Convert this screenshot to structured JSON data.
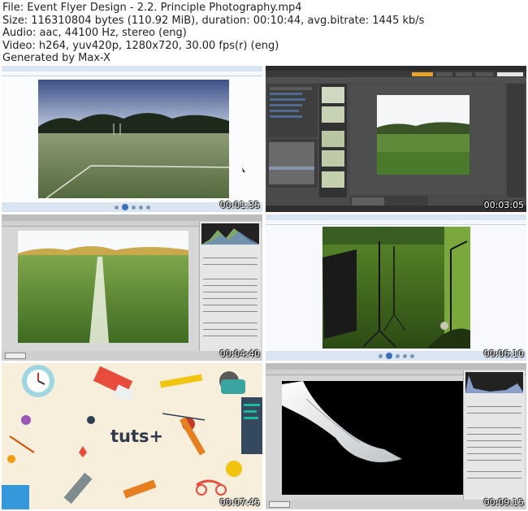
{
  "header": {
    "file_line": "File: Event Flyer Design - 2.2. Principle Photography.mp4",
    "size_line": "Size: 116310804 bytes (110.92 MiB), duration: 00:10:44, avg.bitrate: 1445 kb/s",
    "audio_line": "Audio: aac, 44100 Hz, stereo (eng)",
    "video_line": "Video: h264, yuv420p, 1280x720, 30.00 fps(r) (eng)",
    "generated_line": "Generated by Max-X"
  },
  "thumbnails": [
    {
      "timestamp": "00:01:35",
      "scene": "windows-photo-viewer-field"
    },
    {
      "timestamp": "00:03:05",
      "scene": "adobe-bridge-field"
    },
    {
      "timestamp": "00:04:40",
      "scene": "camera-raw-field-line"
    },
    {
      "timestamp": "00:06:10",
      "scene": "photo-viewer-light-stands"
    },
    {
      "timestamp": "00:07:45",
      "scene": "tuts-plus-splash"
    },
    {
      "timestamp": "00:09:15",
      "scene": "camera-raw-fabric"
    }
  ],
  "brand": {
    "logo_text": "tuts+"
  },
  "colors": {
    "brand_text": "#2e3a4a",
    "splash_bg": "#f7eedc",
    "timestamp": "#ffffff"
  }
}
